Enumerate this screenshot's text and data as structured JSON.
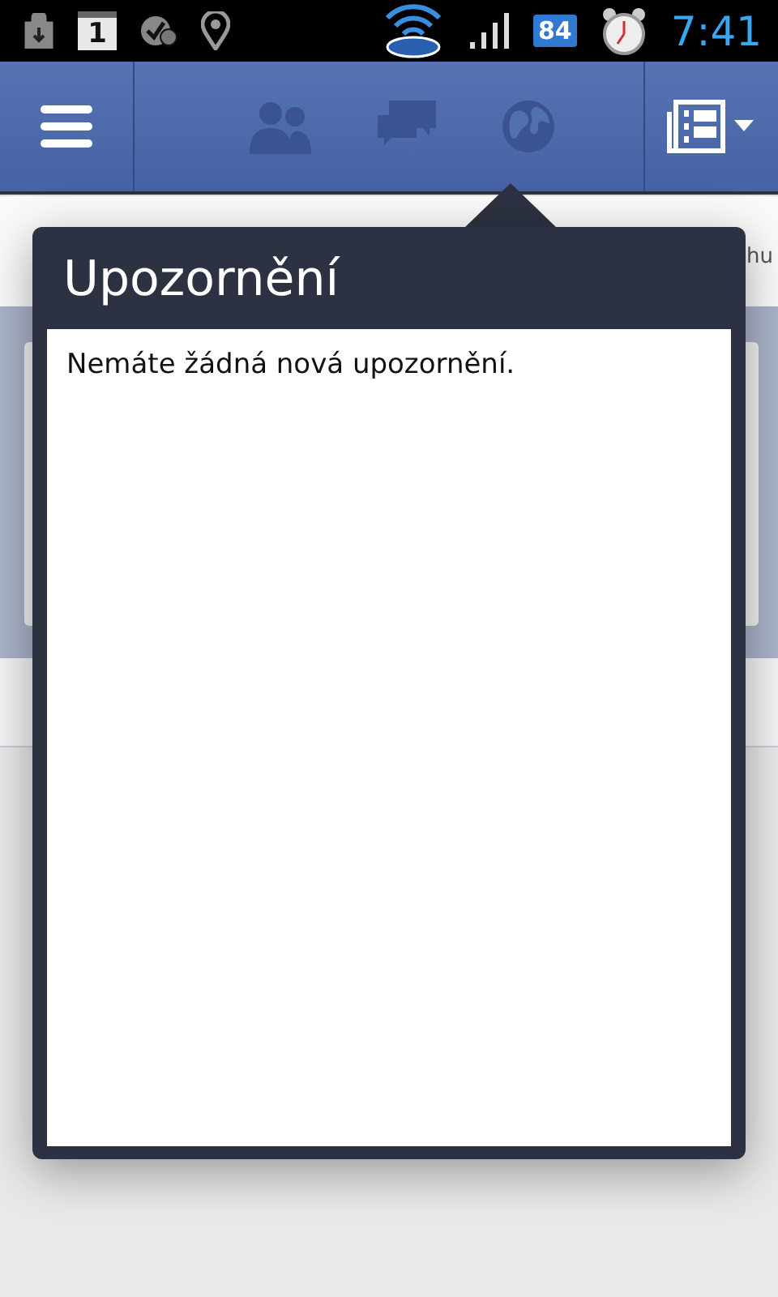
{
  "status_bar": {
    "calendar_day": "1",
    "battery": "84",
    "time": "7:41"
  },
  "background": {
    "tab_fragment": "hu"
  },
  "notifications_popover": {
    "title": "Upozornění",
    "message": "Nemáte žádná nová upozornění."
  }
}
